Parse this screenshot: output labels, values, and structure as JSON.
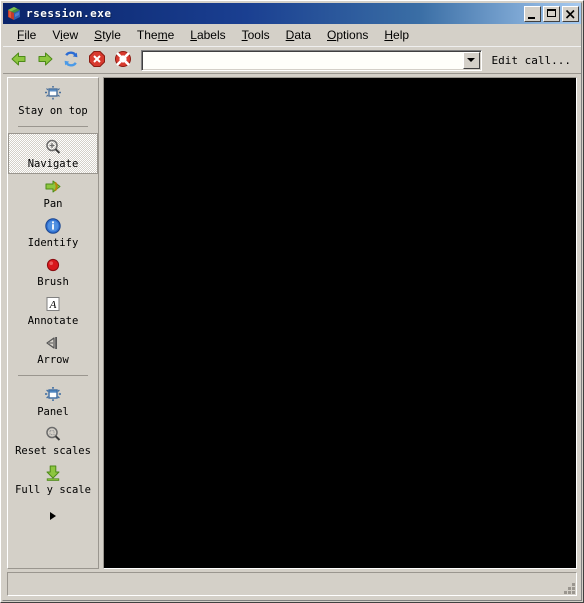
{
  "window": {
    "title": "rsession.exe",
    "app_icon": "cube-icon",
    "controls": [
      {
        "name": "minimize-button",
        "icon": "minimize-icon",
        "label": "_"
      },
      {
        "name": "maximize-button",
        "icon": "maximize-icon",
        "label": "□"
      },
      {
        "name": "close-button",
        "icon": "close-icon",
        "label": "X"
      }
    ]
  },
  "menubar": {
    "items": [
      {
        "label": "File",
        "mnemonic": "F"
      },
      {
        "label": "View",
        "mnemonic": "V"
      },
      {
        "label": "Style",
        "mnemonic": "S"
      },
      {
        "label": "Theme",
        "mnemonic": "m"
      },
      {
        "label": "Labels",
        "mnemonic": "L"
      },
      {
        "label": "Tools",
        "mnemonic": "T"
      },
      {
        "label": "Data",
        "mnemonic": "D"
      },
      {
        "label": "Options",
        "mnemonic": "O"
      },
      {
        "label": "Help",
        "mnemonic": "H"
      }
    ]
  },
  "toolbar": {
    "buttons": [
      {
        "name": "back-button",
        "icon": "left-arrow-icon",
        "color": "#7ac143"
      },
      {
        "name": "forward-button",
        "icon": "right-arrow-icon",
        "color": "#7ac143"
      },
      {
        "name": "refresh-button",
        "icon": "refresh-icon",
        "color": "#2b6cd4"
      },
      {
        "name": "stop-button",
        "icon": "stop-icon",
        "color": "#d83a2e"
      },
      {
        "name": "help-button",
        "icon": "lifebuoy-icon",
        "color": "#d83a2e"
      }
    ],
    "combo": {
      "value": "",
      "placeholder": "",
      "arrow_icon": "chevron-down-icon"
    },
    "edit_call_label": "Edit call..."
  },
  "sidebar": {
    "groups": [
      {
        "items": [
          {
            "label": "Stay on top",
            "icon": "stay-on-top-icon",
            "selected": false
          }
        ]
      },
      {
        "items": [
          {
            "label": "Navigate",
            "icon": "magnifier-plus-icon",
            "selected": true
          },
          {
            "label": "Pan",
            "icon": "pan-hand-arrow-icon",
            "selected": false
          },
          {
            "label": "Identify",
            "icon": "info-icon",
            "selected": false
          },
          {
            "label": "Brush",
            "icon": "red-dot-icon",
            "selected": false
          },
          {
            "label": "Annotate",
            "icon": "letter-a-icon",
            "selected": false
          },
          {
            "label": "Arrow",
            "icon": "arrow-cursor-icon",
            "selected": false
          }
        ]
      },
      {
        "items": [
          {
            "label": "Panel",
            "icon": "panel-icon",
            "selected": false
          },
          {
            "label": "Reset scales",
            "icon": "magnifier-reset-icon",
            "selected": false
          },
          {
            "label": "Full y scale",
            "icon": "green-down-arrow-icon",
            "selected": false
          }
        ]
      }
    ],
    "more_icon": "triangle-right-icon"
  },
  "canvas": {
    "name": "plot-canvas",
    "background": "#000000",
    "content": ""
  },
  "statusbar": {
    "text": "",
    "grip_icon": "resize-grip-icon"
  }
}
